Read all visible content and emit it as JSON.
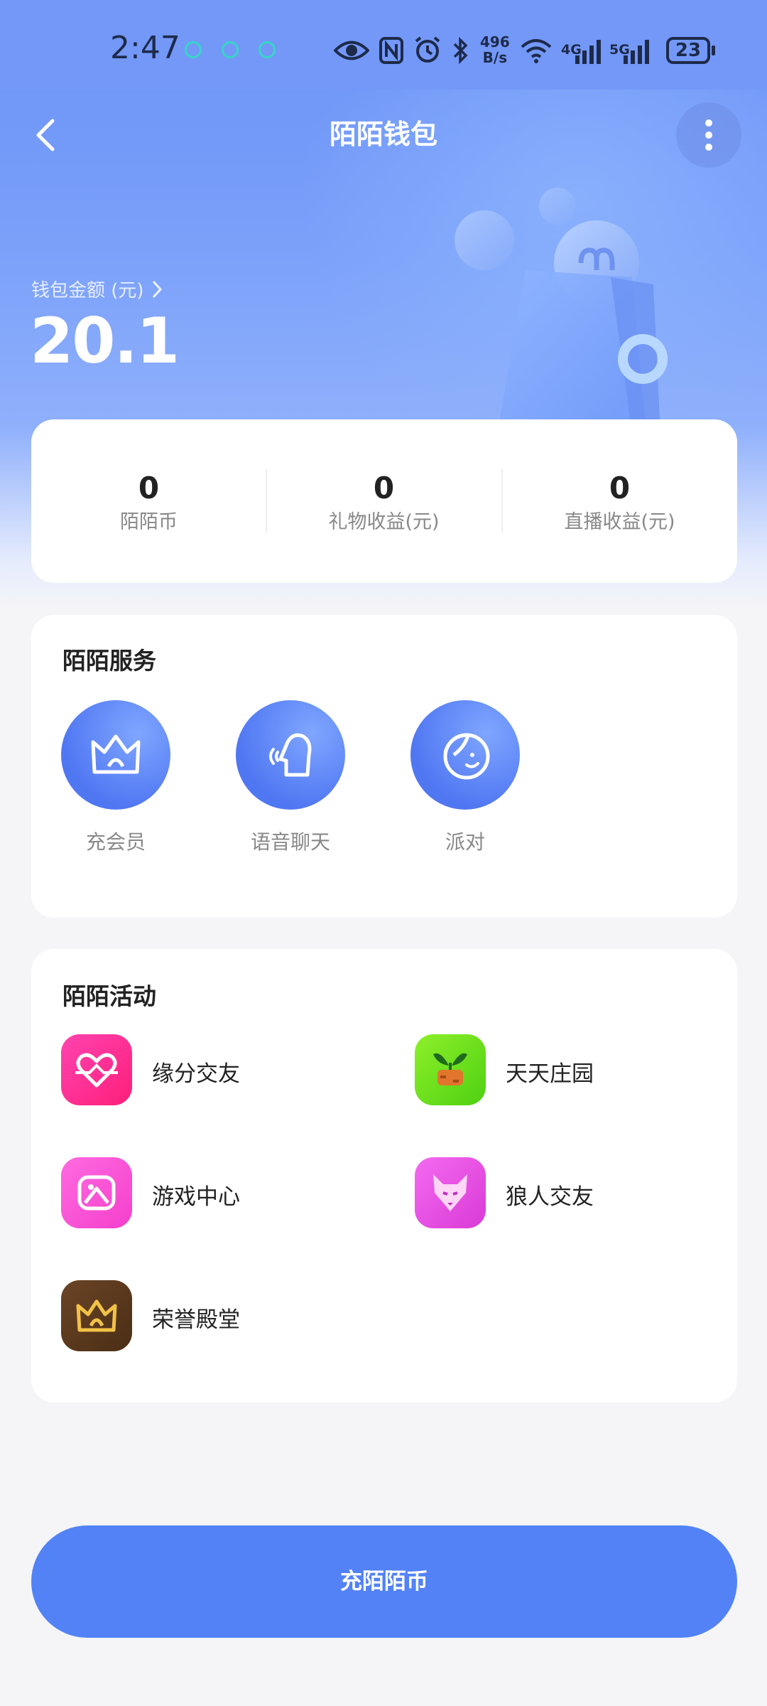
{
  "status_bar": {
    "time": "2:47",
    "net_speed_value": "496",
    "net_speed_unit": "B/s",
    "signal_4g": "4G",
    "signal_5g": "5G",
    "battery": "23"
  },
  "header": {
    "title": "陌陌钱包"
  },
  "balance": {
    "label": "钱包金额 (元)",
    "amount": "20.1"
  },
  "stats": [
    {
      "value": "0",
      "label": "陌陌币"
    },
    {
      "value": "0",
      "label": "礼物收益(元)"
    },
    {
      "value": "0",
      "label": "直播收益(元)"
    }
  ],
  "services": {
    "title": "陌陌服务",
    "items": [
      {
        "label": "充会员",
        "icon": "crown-icon"
      },
      {
        "label": "语音聊天",
        "icon": "voice-chat-icon"
      },
      {
        "label": "派对",
        "icon": "party-face-icon"
      }
    ]
  },
  "activities": {
    "title": "陌陌活动",
    "items": [
      {
        "label": "缘分交友",
        "icon": "heart-icon",
        "color": "#ff2e93"
      },
      {
        "label": "天天庄园",
        "icon": "sprout-icon",
        "color": "#6ce81e"
      },
      {
        "label": "游戏中心",
        "icon": "gamepad-icon",
        "color": "#ff4fd2"
      },
      {
        "label": "狼人交友",
        "icon": "wolf-icon",
        "color": "#ee4be6"
      },
      {
        "label": "荣誉殿堂",
        "icon": "crown-icon",
        "color": "#5a3a20"
      }
    ]
  },
  "cta": {
    "label": "充陌陌币"
  },
  "colors": {
    "brand": "#5282f6",
    "hero_top": "#6c92f7"
  }
}
